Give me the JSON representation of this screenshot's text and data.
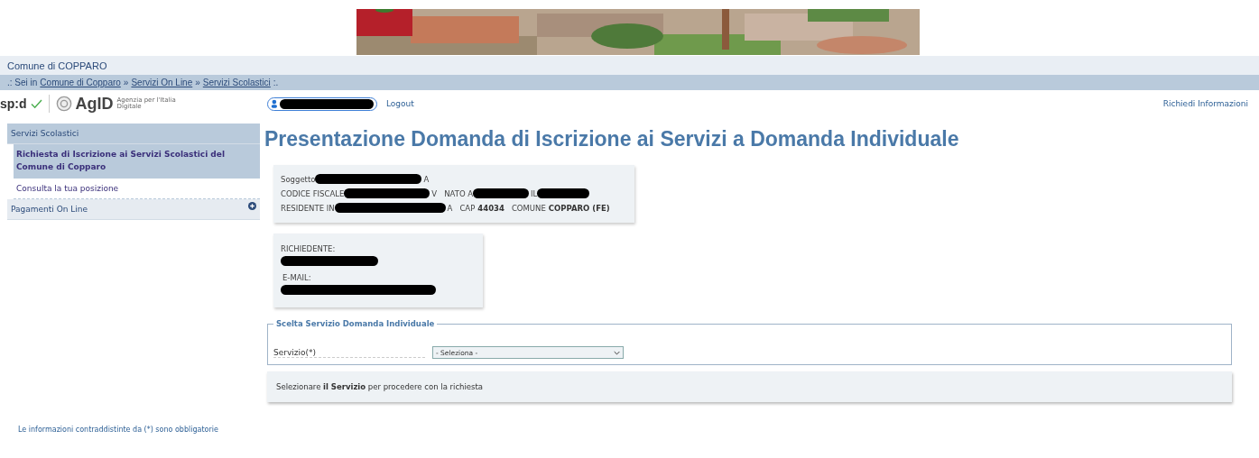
{
  "site_title": "Comune di COPPARO",
  "breadcrumb": {
    "prefix": ".: Sei in",
    "links": [
      "Comune di Copparo",
      "Servizi On Line",
      "Servizi Scolastici"
    ],
    "separator": "»",
    "suffix": ":."
  },
  "logos": {
    "spid": "sp:d",
    "agid": "AgID",
    "agid_caption": "Agenzia per l'Italia Digitale"
  },
  "logout": "Logout",
  "info_link": "Richiedi Informazioni",
  "sidebar": {
    "items": [
      {
        "label": "Servizi Scolastici",
        "expanded": true,
        "children": [
          {
            "label": "Richiesta di Iscrizione ai Servizi Scolastici del Comune di Copparo",
            "selected": true
          },
          {
            "label": "Consulta la tua posizione",
            "selected": false
          }
        ]
      },
      {
        "label": "Pagamenti On Line",
        "expanded": false
      }
    ]
  },
  "page_title": "Presentazione Domanda di Iscrizione ai Servizi a Domanda Individuale",
  "subject": {
    "label": "Soggetto",
    "tail": "A",
    "tax_code_label": "CODICE FISCALE",
    "tax_code_tail": "V",
    "born_label": "NATO A",
    "date_label": "IL",
    "residence_label": "RESIDENTE IN",
    "residence_tail": "A",
    "zip_label": "CAP",
    "zip": "44034",
    "town_label": "COMUNE",
    "town": "COPPARO (FE)"
  },
  "applicant": {
    "name_label": "RICHIEDENTE:",
    "email_label": "E-MAIL:"
  },
  "service_choice": {
    "legend": "Scelta Servizio Domanda Individuale",
    "field_label": "Servizio(*)",
    "value": "- Seleziona -"
  },
  "notice": "Selezionare **il Servizio** per procedere con la richiesta",
  "footnote": "Le informazioni contraddistinte da (*) sono obbligatorie"
}
